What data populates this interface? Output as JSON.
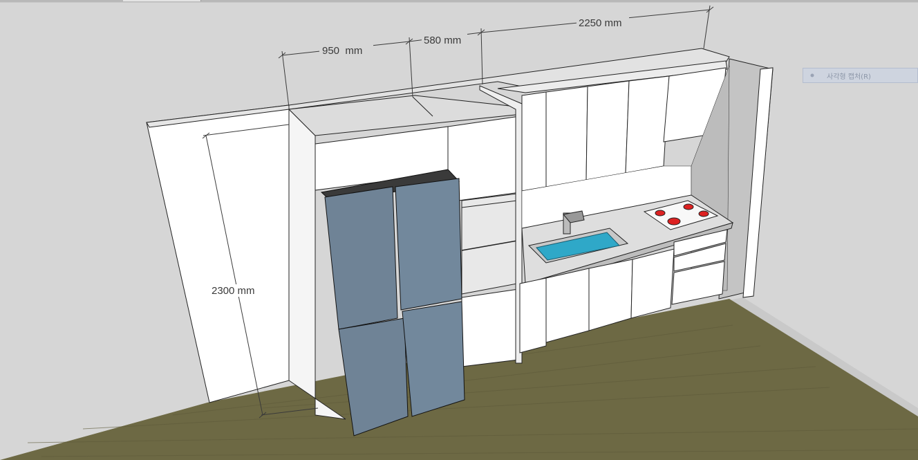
{
  "app": {
    "type": "3d-modeling-viewport",
    "background_color": "#c9c9c9"
  },
  "dimensions": [
    {
      "id": "dim-950",
      "label": "950  mm"
    },
    {
      "id": "dim-580",
      "label": "580 mm"
    },
    {
      "id": "dim-2250",
      "label": "2250 mm"
    },
    {
      "id": "dim-2300",
      "label": "2300 mm"
    }
  ],
  "capture_hint": {
    "label": "사각형 캡처(R)",
    "icon": "capture-dot-icon"
  },
  "colors": {
    "wall": "#d6d6d6",
    "cabinet_white": "#ffffff",
    "fridge_door": "#6f8396",
    "fridge_top": "#3a3a3a",
    "floor": "#6f6a45",
    "sink_water": "#2fa8c8",
    "countertop": "#d9d9d9",
    "burner_red": "#d22"
  }
}
